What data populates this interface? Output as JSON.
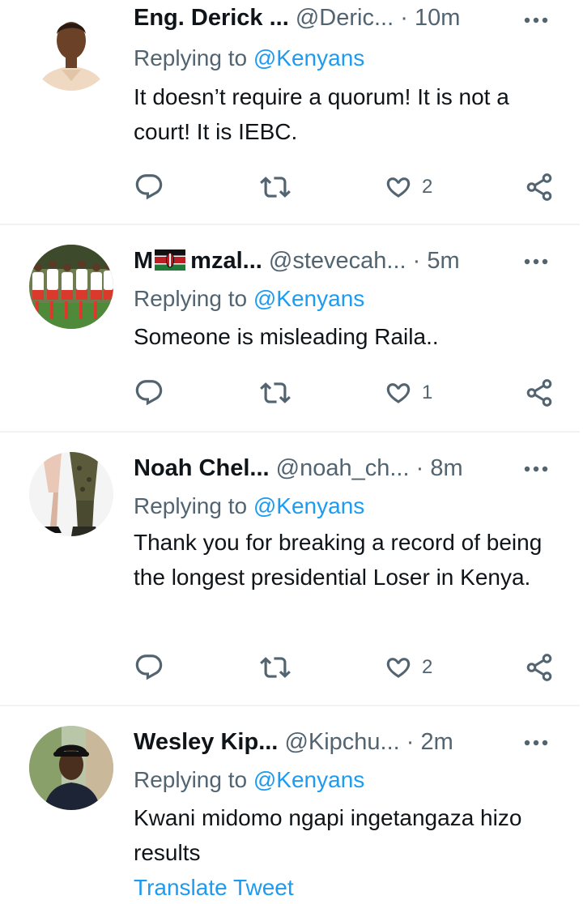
{
  "tweets": [
    {
      "name": "Eng. Derick ...",
      "handle": "@Deric...",
      "dot": "·",
      "time": "10m",
      "replying_prefix": "Replying to ",
      "replying_handle": "@Kenyans",
      "body": "It doesn’t require a quorum! It is not a court! It is IEBC.",
      "likes": "2"
    },
    {
      "name_prefix": "M",
      "name": "mzal...",
      "handle": "@stevecah...",
      "dot": "·",
      "time": "5m",
      "replying_prefix": "Replying to ",
      "replying_handle": "@Kenyans",
      "body": "Someone is misleading Raila..",
      "likes": "1"
    },
    {
      "name": "Noah Chel...",
      "handle": "@noah_ch...",
      "dot": "·",
      "time": "8m",
      "replying_prefix": "Replying to ",
      "replying_handle": "@Kenyans",
      "body": "Thank you for breaking a record of being the longest presidential Loser in Kenya.",
      "likes": "2"
    },
    {
      "name": "Wesley Kip...",
      "handle": "@Kipchu...",
      "dot": "·",
      "time": "2m",
      "replying_prefix": "Replying to ",
      "replying_handle": "@Kenyans",
      "body": "Kwani midomo ngapi ingetangaza hizo results",
      "translate": "Translate Tweet"
    }
  ],
  "icons": {
    "reply": "reply-icon",
    "retweet": "retweet-icon",
    "like": "heart-icon",
    "share": "share-icon",
    "more": "more-icon",
    "flag": "kenya-flag-icon"
  },
  "colors": {
    "accent": "#1d9bf0",
    "secondary_text": "#536471",
    "primary_text": "#0f1419",
    "divider": "#eff3f4"
  }
}
